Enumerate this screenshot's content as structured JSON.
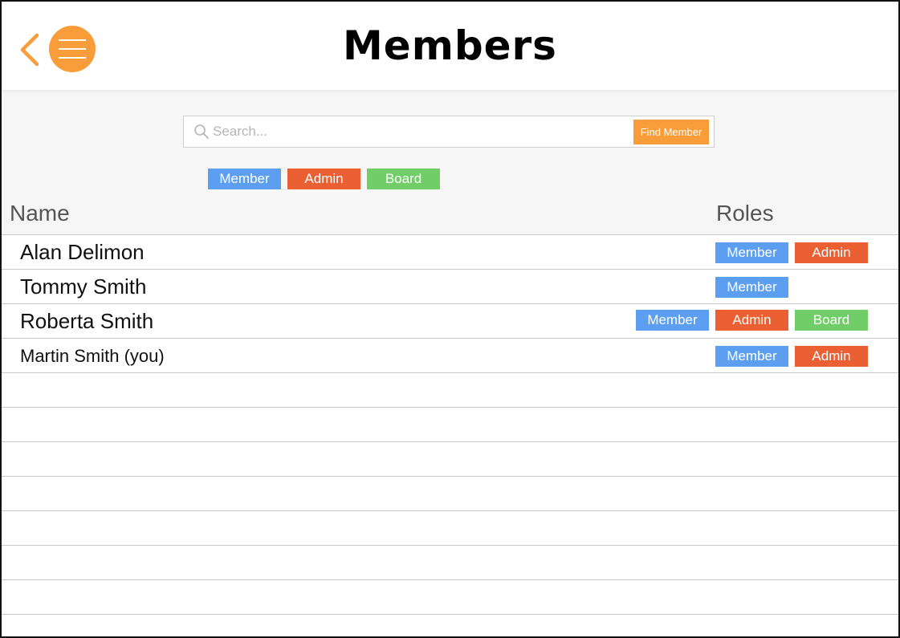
{
  "colors": {
    "accent": "#f99d3a",
    "member": "#5c9ff0",
    "admin": "#ea6033",
    "board": "#71cd68"
  },
  "header": {
    "title": "Members",
    "back_icon": "chevron-left-icon",
    "menu_icon": "hamburger-menu-icon"
  },
  "search": {
    "placeholder": "Search...",
    "value": "",
    "button_label": "Find Member"
  },
  "filters": [
    {
      "label": "Member",
      "role": "member"
    },
    {
      "label": "Admin",
      "role": "admin"
    },
    {
      "label": "Board",
      "role": "board"
    }
  ],
  "table": {
    "columns": [
      "Name",
      "Roles"
    ],
    "rows": [
      {
        "name": "Alan Delimon",
        "roles": [
          "Member",
          "Admin"
        ]
      },
      {
        "name": "Tommy Smith",
        "roles": [
          "Member"
        ]
      },
      {
        "name": "Roberta Smith",
        "roles": [
          "Member",
          "Admin",
          "Board"
        ]
      },
      {
        "name": "Martin Smith (you)",
        "roles": [
          "Member",
          "Admin"
        ]
      }
    ]
  }
}
